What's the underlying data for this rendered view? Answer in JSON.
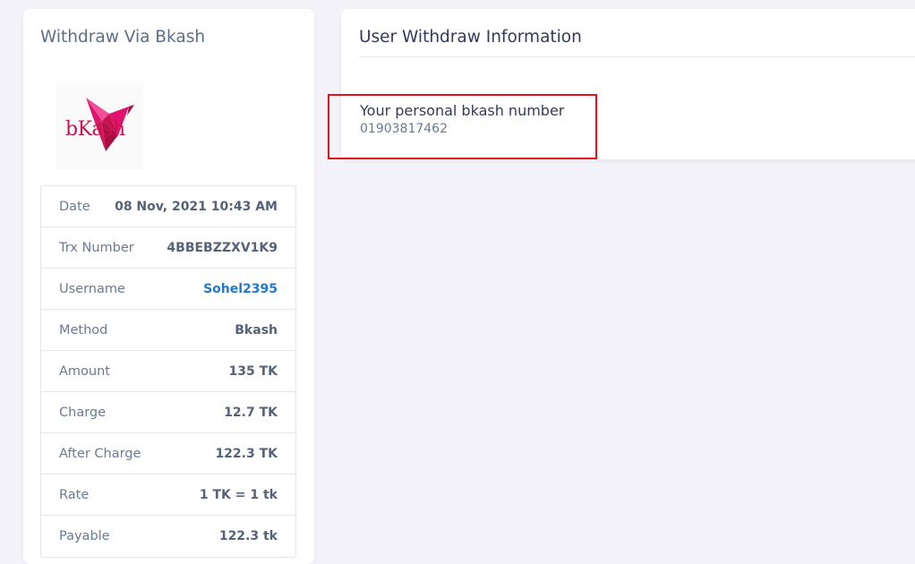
{
  "left_card": {
    "title": "Withdraw Via Bkash",
    "logo_text": "bKash",
    "details": [
      {
        "label": "Date",
        "value": "08 Nov, 2021 10:43 AM",
        "link": false
      },
      {
        "label": "Trx Number",
        "value": "4BBEBZZXV1K9",
        "link": false
      },
      {
        "label": "Username",
        "value": "Sohel2395",
        "link": true
      },
      {
        "label": "Method",
        "value": "Bkash",
        "link": false
      },
      {
        "label": "Amount",
        "value": "135 TK",
        "link": false
      },
      {
        "label": "Charge",
        "value": "12.7 TK",
        "link": false
      },
      {
        "label": "After Charge",
        "value": "122.3 TK",
        "link": false
      },
      {
        "label": "Rate",
        "value": "1 TK = 1 tk",
        "link": false
      },
      {
        "label": "Payable",
        "value": "122.3 tk",
        "link": false
      }
    ]
  },
  "right_card": {
    "title": "User Withdraw Information",
    "info_label": "Your personal bkash number",
    "info_value": "01903817462"
  },
  "colors": {
    "page_background": "#f3f3f9",
    "link": "#1f78d1",
    "brand": "#c8144e",
    "highlight": "#e3111b"
  }
}
